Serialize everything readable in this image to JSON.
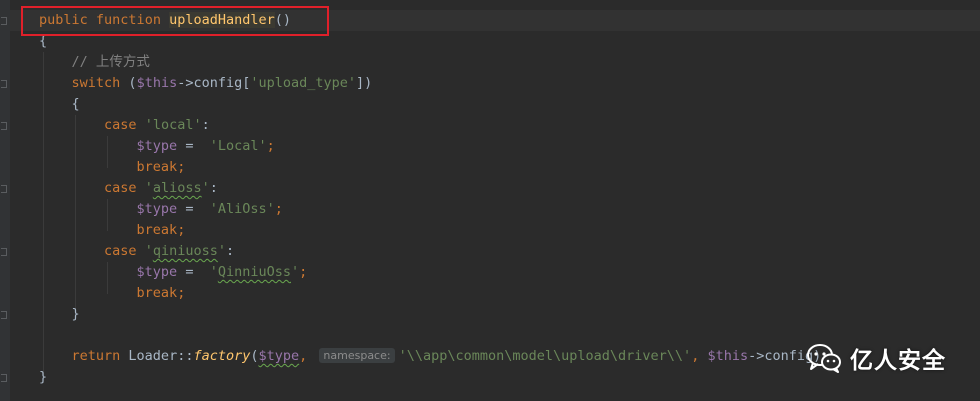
{
  "editor": {
    "lines": [
      {
        "tokens": [
          {
            "t": "public",
            "c": "kw"
          },
          {
            "t": " ",
            "c": ""
          },
          {
            "t": "function",
            "c": "kw"
          },
          {
            "t": " ",
            "c": ""
          },
          {
            "t": "uploadHandler",
            "c": "fn fn-hl"
          },
          {
            "t": "()",
            "c": ""
          }
        ]
      },
      {
        "tokens": [
          {
            "t": "{",
            "c": ""
          }
        ]
      },
      {
        "tokens": [
          {
            "t": "    ",
            "c": ""
          },
          {
            "t": "// 上传方式",
            "c": "cmt"
          }
        ]
      },
      {
        "tokens": [
          {
            "t": "    ",
            "c": ""
          },
          {
            "t": "switch",
            "c": "kw"
          },
          {
            "t": " (",
            "c": ""
          },
          {
            "t": "$this",
            "c": "var"
          },
          {
            "t": "->config[",
            "c": ""
          },
          {
            "t": "'upload_type'",
            "c": "str"
          },
          {
            "t": "])",
            "c": ""
          }
        ]
      },
      {
        "tokens": [
          {
            "t": "    {",
            "c": ""
          }
        ]
      },
      {
        "tokens": [
          {
            "t": "        ",
            "c": ""
          },
          {
            "t": "case",
            "c": "kw"
          },
          {
            "t": " ",
            "c": ""
          },
          {
            "t": "'local'",
            "c": "str"
          },
          {
            "t": ":",
            "c": ""
          }
        ]
      },
      {
        "tokens": [
          {
            "t": "            ",
            "c": ""
          },
          {
            "t": "$type",
            "c": "var"
          },
          {
            "t": " =  ",
            "c": ""
          },
          {
            "t": "'Local'",
            "c": "str"
          },
          {
            "t": ";",
            "c": "kw"
          }
        ]
      },
      {
        "tokens": [
          {
            "t": "            ",
            "c": ""
          },
          {
            "t": "break",
            "c": "kw"
          },
          {
            "t": ";",
            "c": "kw"
          }
        ]
      },
      {
        "tokens": [
          {
            "t": "        ",
            "c": ""
          },
          {
            "t": "case",
            "c": "kw"
          },
          {
            "t": " ",
            "c": ""
          },
          {
            "t": "'",
            "c": "str"
          },
          {
            "t": "alioss",
            "c": "str squig"
          },
          {
            "t": "'",
            "c": "str"
          },
          {
            "t": ":",
            "c": ""
          }
        ]
      },
      {
        "tokens": [
          {
            "t": "            ",
            "c": ""
          },
          {
            "t": "$type",
            "c": "var"
          },
          {
            "t": " =  ",
            "c": ""
          },
          {
            "t": "'AliOss'",
            "c": "str"
          },
          {
            "t": ";",
            "c": "kw"
          }
        ]
      },
      {
        "tokens": [
          {
            "t": "            ",
            "c": ""
          },
          {
            "t": "break",
            "c": "kw"
          },
          {
            "t": ";",
            "c": "kw"
          }
        ]
      },
      {
        "tokens": [
          {
            "t": "        ",
            "c": ""
          },
          {
            "t": "case",
            "c": "kw"
          },
          {
            "t": " ",
            "c": ""
          },
          {
            "t": "'",
            "c": "str"
          },
          {
            "t": "qiniuoss",
            "c": "str squig"
          },
          {
            "t": "'",
            "c": "str"
          },
          {
            "t": ":",
            "c": ""
          }
        ]
      },
      {
        "tokens": [
          {
            "t": "            ",
            "c": ""
          },
          {
            "t": "$type",
            "c": "var"
          },
          {
            "t": " =  ",
            "c": ""
          },
          {
            "t": "'",
            "c": "str"
          },
          {
            "t": "QinniuOss",
            "c": "str squig"
          },
          {
            "t": "'",
            "c": "str"
          },
          {
            "t": ";",
            "c": "kw"
          }
        ]
      },
      {
        "tokens": [
          {
            "t": "            ",
            "c": ""
          },
          {
            "t": "break",
            "c": "kw"
          },
          {
            "t": ";",
            "c": "kw"
          }
        ]
      },
      {
        "tokens": [
          {
            "t": "    }",
            "c": ""
          }
        ]
      },
      {
        "tokens": [
          {
            "t": "",
            "c": ""
          }
        ]
      },
      {
        "tokens": [
          {
            "t": "    ",
            "c": ""
          },
          {
            "t": "return",
            "c": "kw"
          },
          {
            "t": " Loader::",
            "c": ""
          },
          {
            "t": "factory",
            "c": "fn it"
          },
          {
            "t": "(",
            "c": ""
          },
          {
            "t": "$type",
            "c": "var squig"
          },
          {
            "t": ", ",
            "c": "kw"
          },
          {
            "t": "namespace:",
            "c": "hint"
          },
          {
            "t": "'\\\\app\\common\\model\\upload\\driver\\\\'",
            "c": "str"
          },
          {
            "t": ", ",
            "c": "kw"
          },
          {
            "t": "$this",
            "c": "var"
          },
          {
            "t": "->config)",
            "c": ""
          }
        ]
      },
      {
        "tokens": [
          {
            "t": "}",
            "c": ""
          }
        ]
      }
    ]
  },
  "watermark": {
    "text": "亿人安全",
    "icon": "wechat-icon"
  },
  "colors": {
    "background": "#2b2b2b",
    "keyword": "#cc7832",
    "function": "#ffc66d",
    "string": "#6a8759",
    "variable": "#9876aa",
    "comment": "#808080",
    "text": "#a9b7c6",
    "highlight_box": "#e0202a"
  }
}
